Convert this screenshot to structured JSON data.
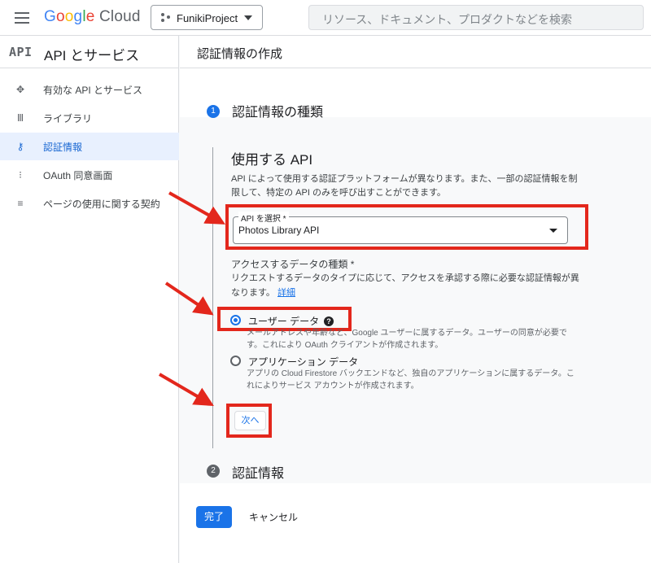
{
  "header": {
    "logo_google": [
      "G",
      "o",
      "o",
      "g",
      "l",
      "e"
    ],
    "logo_cloud": "Cloud",
    "project": "FunikiProject",
    "search_placeholder": "リソース、ドキュメント、プロダクトなどを検索"
  },
  "sidebar": {
    "title": "API とサービス",
    "items": [
      {
        "label": "有効な API とサービス",
        "icon": "api-diamond-icon"
      },
      {
        "label": "ライブラリ",
        "icon": "library-icon"
      },
      {
        "label": "認証情報",
        "icon": "key-icon"
      },
      {
        "label": "OAuth 同意画面",
        "icon": "consent-icon"
      },
      {
        "label": "ページの使用に関する契約",
        "icon": "settings-list-icon"
      }
    ]
  },
  "main": {
    "page_title": "認証情報の作成",
    "step1": {
      "number": "1",
      "title": "認証情報の種類"
    },
    "section_title": "使用する API",
    "section_desc": "API によって使用する認証プラットフォームが異なります。また、一部の認証情報を制限して、特定の API のみを呼び出すことができます。",
    "api_select": {
      "label": "API を選択 *",
      "value": "Photos Library API"
    },
    "data_type": {
      "label": "アクセスするデータの種類 *",
      "desc": "リクエストするデータのタイプに応じて、アクセスを承認する際に必要な認証情報が異なります。",
      "link": "詳細",
      "options": [
        {
          "label": "ユーザー データ",
          "desc": "メールアドレスや年齢など、Google ユーザーに属するデータ。ユーザーの同意が必要です。これにより OAuth クライアントが作成されます。",
          "selected": true
        },
        {
          "label": "アプリケーション データ",
          "desc": "アプリの Cloud Firestore バックエンドなど、独自のアプリケーションに属するデータ。これによりサービス アカウントが作成されます。",
          "selected": false
        }
      ]
    },
    "next_label": "次へ",
    "step2": {
      "number": "2",
      "title": "認証情報"
    },
    "done_label": "完了",
    "cancel_label": "キャンセル"
  },
  "annotations": {
    "highlight_color": "#e3271c"
  }
}
